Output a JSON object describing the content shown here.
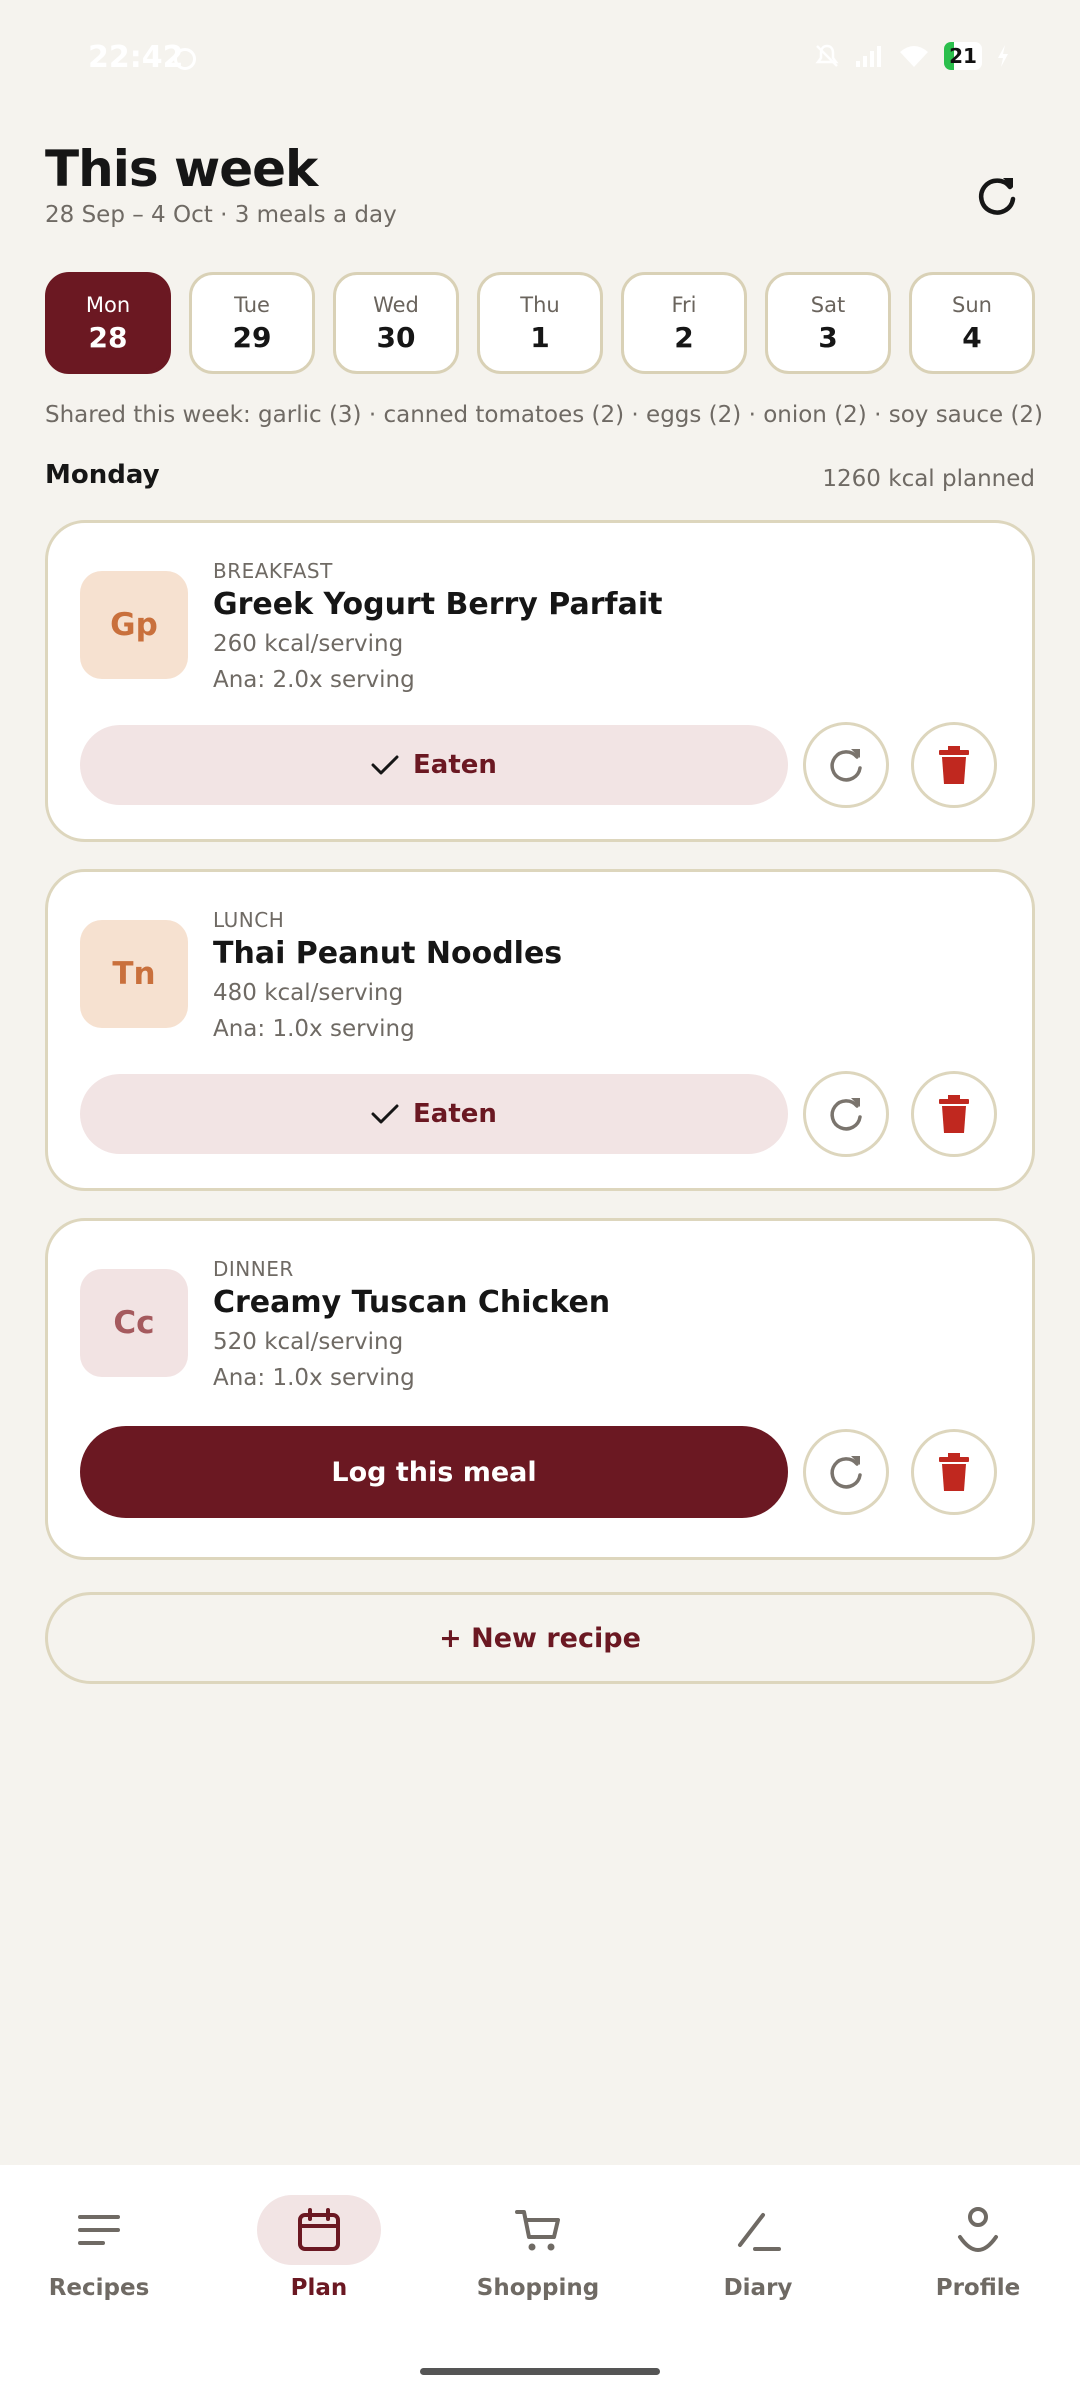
{
  "status": {
    "time": "22:42",
    "battery": "21"
  },
  "header": {
    "title": "This week",
    "subtitle": "28 Sep – 4 Oct · 3 meals a day"
  },
  "days": [
    {
      "name": "Mon",
      "date": "28",
      "active": true
    },
    {
      "name": "Tue",
      "date": "29"
    },
    {
      "name": "Wed",
      "date": "30"
    },
    {
      "name": "Thu",
      "date": "1"
    },
    {
      "name": "Fri",
      "date": "2"
    },
    {
      "name": "Sat",
      "date": "3"
    },
    {
      "name": "Sun",
      "date": "4"
    }
  ],
  "shared": "Shared this week: garlic (3) · canned tomatoes (2) · eggs (2) · onion (2) · soy sauce (2)",
  "day_title": "Monday",
  "planned": "1260 kcal planned",
  "meals": [
    {
      "badge": "Gp",
      "type": "BREAKFAST",
      "name": "Greek Yogurt Berry Parfait",
      "kcal": "260 kcal/serving",
      "serving": "Ana: 2.0x serving",
      "action": "Eaten"
    },
    {
      "badge": "Tn",
      "type": "LUNCH",
      "name": "Thai Peanut Noodles",
      "kcal": "480 kcal/serving",
      "serving": "Ana: 1.0x serving",
      "action": "Eaten"
    },
    {
      "badge": "Cc",
      "type": "DINNER",
      "name": "Creamy Tuscan Chicken",
      "kcal": "520 kcal/serving",
      "serving": "Ana: 1.0x serving",
      "action": "Log this meal"
    }
  ],
  "new_recipe": "+ New recipe",
  "nav": [
    {
      "label": "Recipes",
      "icon": "menu-icon"
    },
    {
      "label": "Plan",
      "icon": "calendar-icon",
      "active": true
    },
    {
      "label": "Shopping",
      "icon": "cart-icon"
    },
    {
      "label": "Diary",
      "icon": "pencil-icon"
    },
    {
      "label": "Profile",
      "icon": "person-icon"
    }
  ],
  "colors": {
    "accent": "#6b1822",
    "background": "#f5f3ee",
    "border": "#ddd6bd",
    "trash": "#c0281f"
  }
}
